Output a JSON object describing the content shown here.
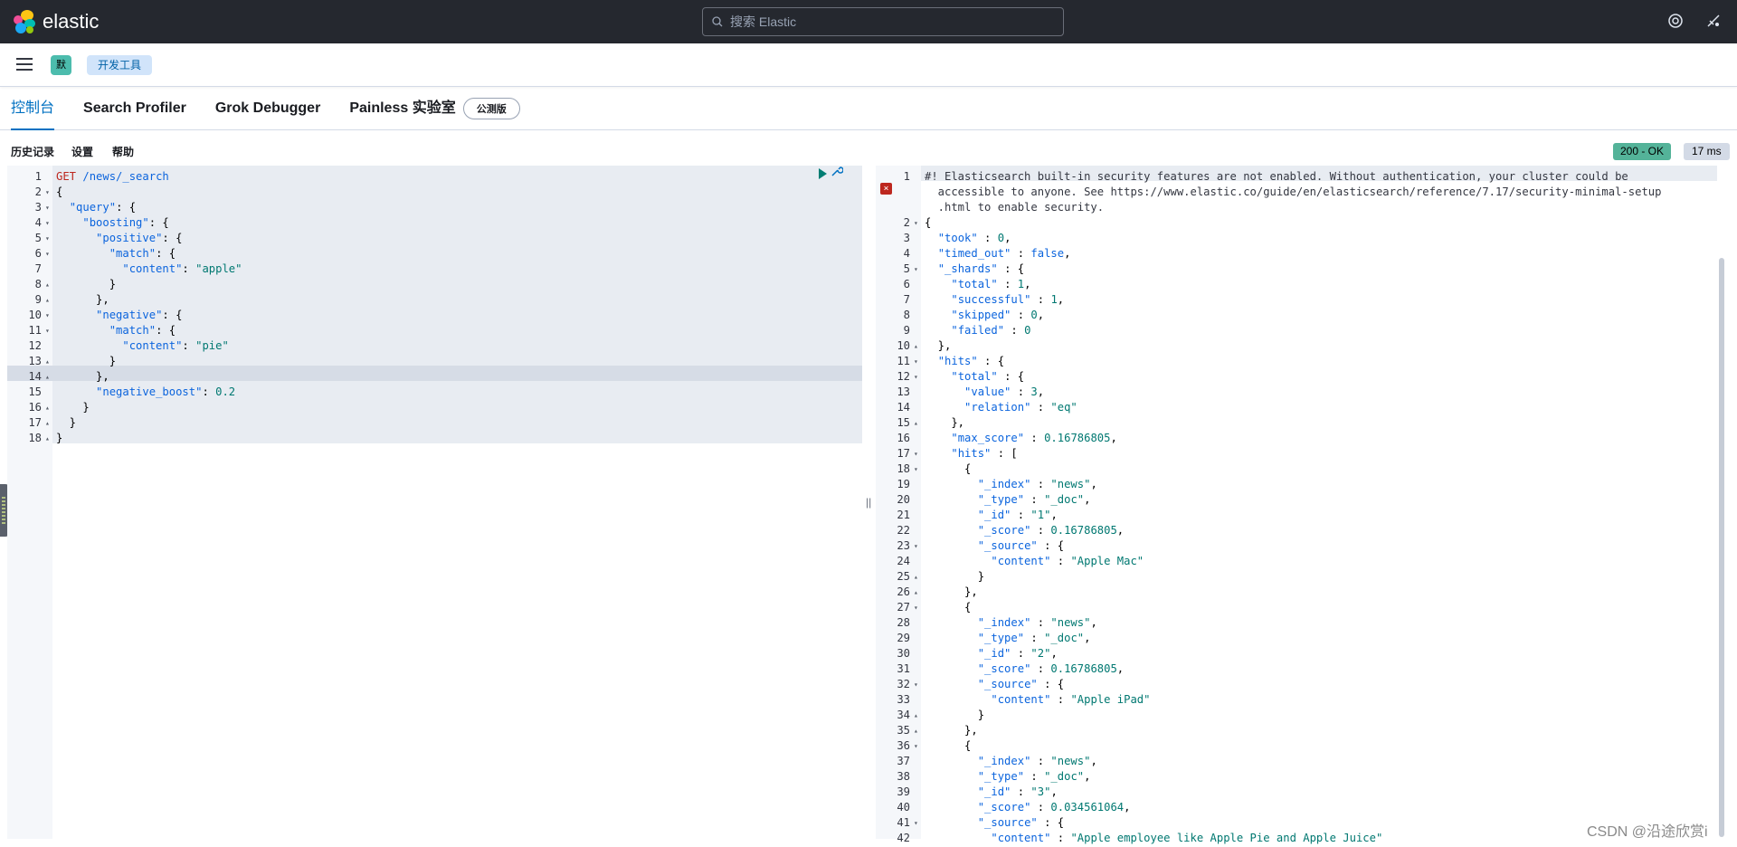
{
  "topbar": {
    "logo_text": "elastic",
    "search_placeholder": "搜索 Elastic",
    "help_icon": "help-circle-icon",
    "news_icon": "newsfeed-icon"
  },
  "subbar": {
    "space_badge": "默",
    "breadcrumb": "开发工具"
  },
  "tabs": [
    {
      "label": "控制台"
    },
    {
      "label": "Search Profiler"
    },
    {
      "label": "Grok Debugger"
    },
    {
      "label": "Painless 实验室"
    }
  ],
  "beta_badge": "公测版",
  "toolbar": {
    "history": "历史记录",
    "settings": "设置",
    "help": "帮助"
  },
  "status": {
    "code": "200 - OK",
    "time": "17 ms"
  },
  "request_lines": [
    {
      "n": "1",
      "f": "",
      "t": "GET /news/_search"
    },
    {
      "n": "2",
      "f": "▾",
      "t": "{"
    },
    {
      "n": "3",
      "f": "▾",
      "t": "  \"query\": {"
    },
    {
      "n": "4",
      "f": "▾",
      "t": "    \"boosting\": {"
    },
    {
      "n": "5",
      "f": "▾",
      "t": "      \"positive\": {"
    },
    {
      "n": "6",
      "f": "▾",
      "t": "        \"match\": {"
    },
    {
      "n": "7",
      "f": "",
      "t": "          \"content\": \"apple\""
    },
    {
      "n": "8",
      "f": "▴",
      "t": "        }"
    },
    {
      "n": "9",
      "f": "▴",
      "t": "      },"
    },
    {
      "n": "10",
      "f": "▾",
      "t": "      \"negative\": {"
    },
    {
      "n": "11",
      "f": "▾",
      "t": "        \"match\": {"
    },
    {
      "n": "12",
      "f": "",
      "t": "          \"content\": \"pie\""
    },
    {
      "n": "13",
      "f": "▴",
      "t": "        }"
    },
    {
      "n": "14",
      "f": "▴",
      "t": "      },"
    },
    {
      "n": "15",
      "f": "",
      "t": "      \"negative_boost\": 0.2"
    },
    {
      "n": "16",
      "f": "▴",
      "t": "    }"
    },
    {
      "n": "17",
      "f": "▴",
      "t": "  }"
    },
    {
      "n": "18",
      "f": "▴",
      "t": "}"
    }
  ],
  "response_lines": [
    {
      "n": "1",
      "f": "",
      "t": "#! Elasticsearch built-in security features are not enabled. Without authentication, your cluster could be"
    },
    {
      "n": "",
      "f": "",
      "t": "  accessible to anyone. See https://www.elastic.co/guide/en/elasticsearch/reference/7.17/security-minimal-setup"
    },
    {
      "n": "",
      "f": "",
      "t": "  .html to enable security."
    },
    {
      "n": "2",
      "f": "▾",
      "t": "{"
    },
    {
      "n": "3",
      "f": "",
      "t": "  \"took\" : 0,"
    },
    {
      "n": "4",
      "f": "",
      "t": "  \"timed_out\" : false,"
    },
    {
      "n": "5",
      "f": "▾",
      "t": "  \"_shards\" : {"
    },
    {
      "n": "6",
      "f": "",
      "t": "    \"total\" : 1,"
    },
    {
      "n": "7",
      "f": "",
      "t": "    \"successful\" : 1,"
    },
    {
      "n": "8",
      "f": "",
      "t": "    \"skipped\" : 0,"
    },
    {
      "n": "9",
      "f": "",
      "t": "    \"failed\" : 0"
    },
    {
      "n": "10",
      "f": "▴",
      "t": "  },"
    },
    {
      "n": "11",
      "f": "▾",
      "t": "  \"hits\" : {"
    },
    {
      "n": "12",
      "f": "▾",
      "t": "    \"total\" : {"
    },
    {
      "n": "13",
      "f": "",
      "t": "      \"value\" : 3,"
    },
    {
      "n": "14",
      "f": "",
      "t": "      \"relation\" : \"eq\""
    },
    {
      "n": "15",
      "f": "▴",
      "t": "    },"
    },
    {
      "n": "16",
      "f": "",
      "t": "    \"max_score\" : 0.16786805,"
    },
    {
      "n": "17",
      "f": "▾",
      "t": "    \"hits\" : ["
    },
    {
      "n": "18",
      "f": "▾",
      "t": "      {"
    },
    {
      "n": "19",
      "f": "",
      "t": "        \"_index\" : \"news\","
    },
    {
      "n": "20",
      "f": "",
      "t": "        \"_type\" : \"_doc\","
    },
    {
      "n": "21",
      "f": "",
      "t": "        \"_id\" : \"1\","
    },
    {
      "n": "22",
      "f": "",
      "t": "        \"_score\" : 0.16786805,"
    },
    {
      "n": "23",
      "f": "▾",
      "t": "        \"_source\" : {"
    },
    {
      "n": "24",
      "f": "",
      "t": "          \"content\" : \"Apple Mac\""
    },
    {
      "n": "25",
      "f": "▴",
      "t": "        }"
    },
    {
      "n": "26",
      "f": "▴",
      "t": "      },"
    },
    {
      "n": "27",
      "f": "▾",
      "t": "      {"
    },
    {
      "n": "28",
      "f": "",
      "t": "        \"_index\" : \"news\","
    },
    {
      "n": "29",
      "f": "",
      "t": "        \"_type\" : \"_doc\","
    },
    {
      "n": "30",
      "f": "",
      "t": "        \"_id\" : \"2\","
    },
    {
      "n": "31",
      "f": "",
      "t": "        \"_score\" : 0.16786805,"
    },
    {
      "n": "32",
      "f": "▾",
      "t": "        \"_source\" : {"
    },
    {
      "n": "33",
      "f": "",
      "t": "          \"content\" : \"Apple iPad\""
    },
    {
      "n": "34",
      "f": "▴",
      "t": "        }"
    },
    {
      "n": "35",
      "f": "▴",
      "t": "      },"
    },
    {
      "n": "36",
      "f": "▾",
      "t": "      {"
    },
    {
      "n": "37",
      "f": "",
      "t": "        \"_index\" : \"news\","
    },
    {
      "n": "38",
      "f": "",
      "t": "        \"_type\" : \"_doc\","
    },
    {
      "n": "39",
      "f": "",
      "t": "        \"_id\" : \"3\","
    },
    {
      "n": "40",
      "f": "",
      "t": "        \"_score\" : 0.034561064,"
    },
    {
      "n": "41",
      "f": "▾",
      "t": "        \"_source\" : {"
    },
    {
      "n": "42",
      "f": "",
      "t": "          \"content\" : \"Apple employee like Apple Pie and Apple Juice\""
    }
  ],
  "watermark": "CSDN @沿途欣赏i"
}
